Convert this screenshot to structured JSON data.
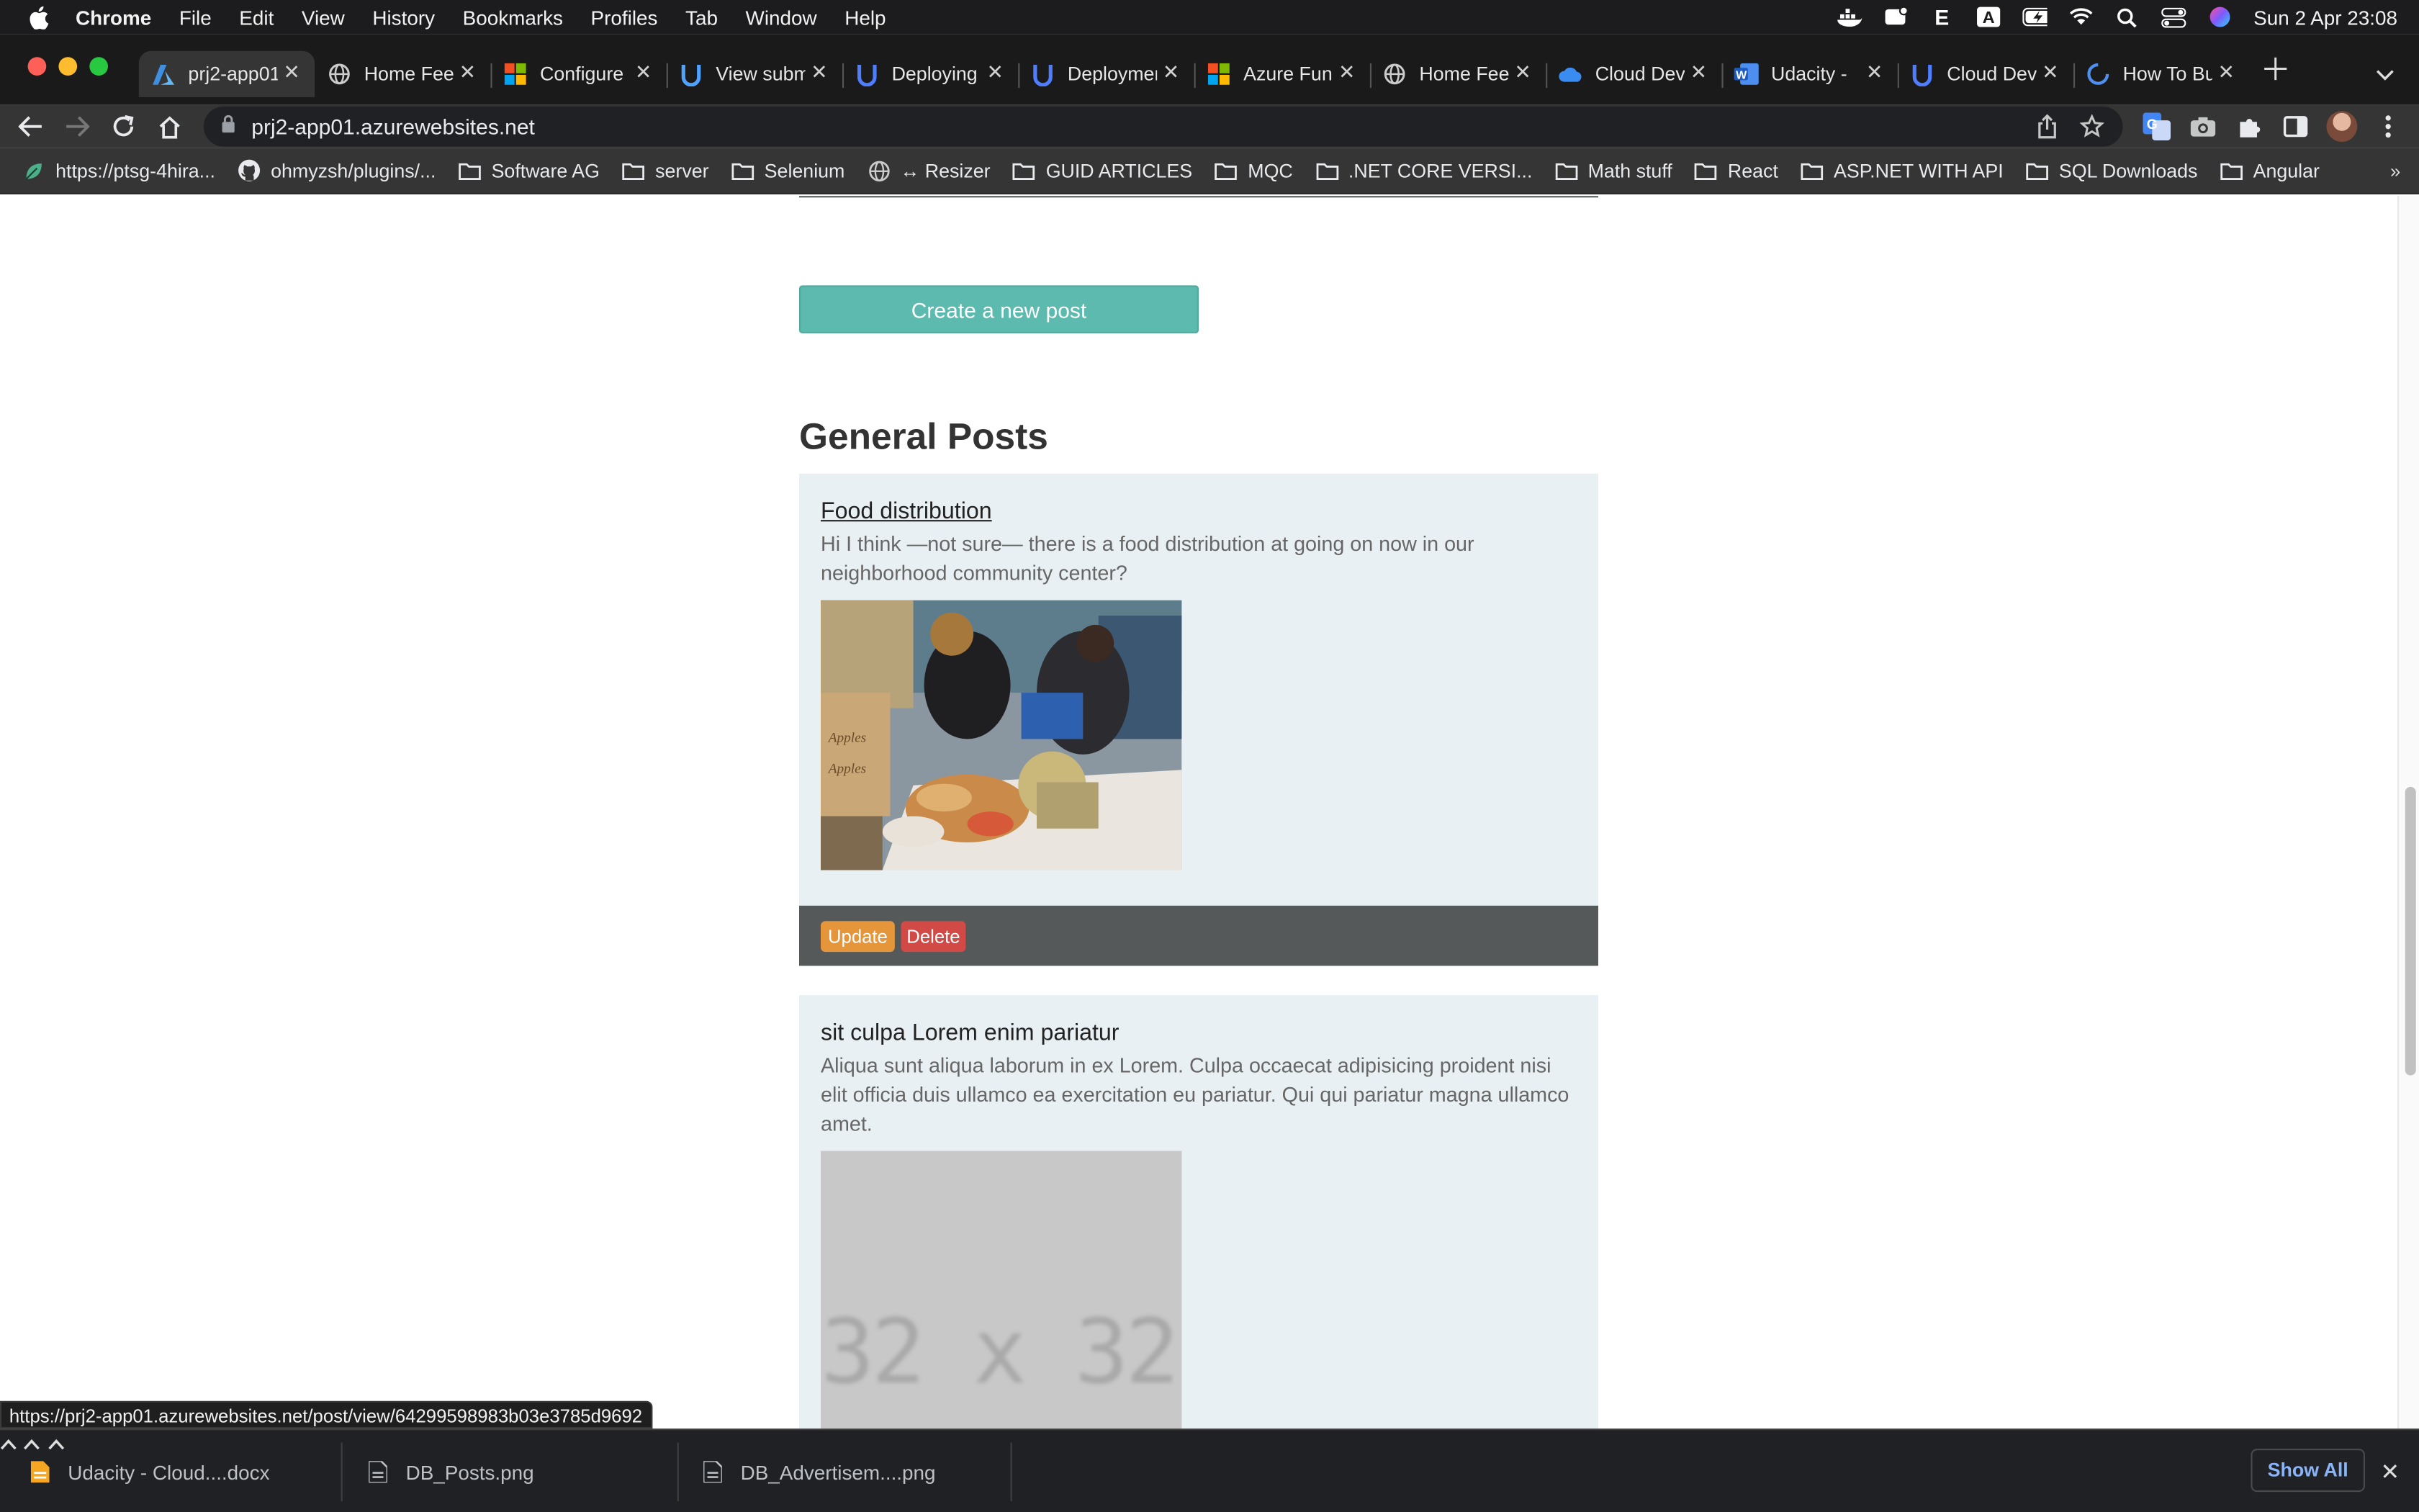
{
  "menubar": {
    "app": "Chrome",
    "items": [
      "File",
      "Edit",
      "View",
      "History",
      "Bookmarks",
      "Profiles",
      "Tab",
      "Window",
      "Help"
    ],
    "clock": "Sun 2 Apr  23:08"
  },
  "tabs": [
    {
      "label": "prj2-app01",
      "icon": "azure-icon",
      "active": true
    },
    {
      "label": "Home Feed",
      "icon": "globe-icon"
    },
    {
      "label": "Configure",
      "icon": "microsoft-icon"
    },
    {
      "label": "View submission",
      "icon": "udacity-icon"
    },
    {
      "label": "Deploying",
      "icon": "udacity-icon"
    },
    {
      "label": "Deployment",
      "icon": "udacity-icon"
    },
    {
      "label": "Azure Functions",
      "icon": "microsoft-icon"
    },
    {
      "label": "Home Feed",
      "icon": "globe-icon"
    },
    {
      "label": "Cloud Dev",
      "icon": "cloud-icon"
    },
    {
      "label": "Udacity -",
      "icon": "word-icon"
    },
    {
      "label": "Cloud Dev",
      "icon": "udacity-icon"
    },
    {
      "label": "How To Build",
      "icon": "loading-icon"
    }
  ],
  "omnibox": {
    "url": "prj2-app01.azurewebsites.net"
  },
  "bookmarks": [
    {
      "label": "https://ptsg-4hira...",
      "icon": "leaf-icon"
    },
    {
      "label": "ohmyzsh/plugins/...",
      "icon": "github-icon"
    },
    {
      "label": "Software AG",
      "icon": "folder-icon"
    },
    {
      "label": "server",
      "icon": "folder-icon"
    },
    {
      "label": "Selenium",
      "icon": "folder-icon"
    },
    {
      "label": "↔ Resizer",
      "icon": "globe-icon"
    },
    {
      "label": "GUID ARTICLES",
      "icon": "folder-icon"
    },
    {
      "label": "MQC",
      "icon": "folder-icon"
    },
    {
      "label": ".NET CORE VERSI...",
      "icon": "folder-icon"
    },
    {
      "label": "Math stuff",
      "icon": "folder-icon"
    },
    {
      "label": "React",
      "icon": "folder-icon"
    },
    {
      "label": "ASP.NET WITH API",
      "icon": "folder-icon"
    },
    {
      "label": "SQL Downloads",
      "icon": "folder-icon"
    },
    {
      "label": "Angular",
      "icon": "folder-icon"
    }
  ],
  "page": {
    "create_button": "Create a new post",
    "section_title": "General Posts",
    "posts": [
      {
        "title": "Food distribution",
        "body": "Hi I think —not sure— there is a food distribution at going on now in our neighborhood community center?",
        "update_label": "Update",
        "delete_label": "Delete"
      },
      {
        "title": "sit culpa Lorem enim pariatur",
        "body": "Aliqua sunt aliqua laborum in ex Lorem. Culpa occaecat adipisicing proident nisi elit officia duis ullamco ea exercitation eu pariatur. Qui qui pariatur magna ullamco amet.",
        "image_placeholder": "32 x 32"
      }
    ]
  },
  "status_url": "https://prj2-app01.azurewebsites.net/post/view/64299598983b03e3785d9692",
  "downloads": {
    "items": [
      "Udacity - Cloud....docx",
      "DB_Posts.png",
      "DB_Advertisem....png"
    ],
    "show_all": "Show All"
  },
  "colors": {
    "create_button": "#5cbaae",
    "update_button": "#e5963a",
    "delete_button": "#d24a45",
    "card_bg": "#e9f0f3",
    "card_footer": "#55595a"
  }
}
